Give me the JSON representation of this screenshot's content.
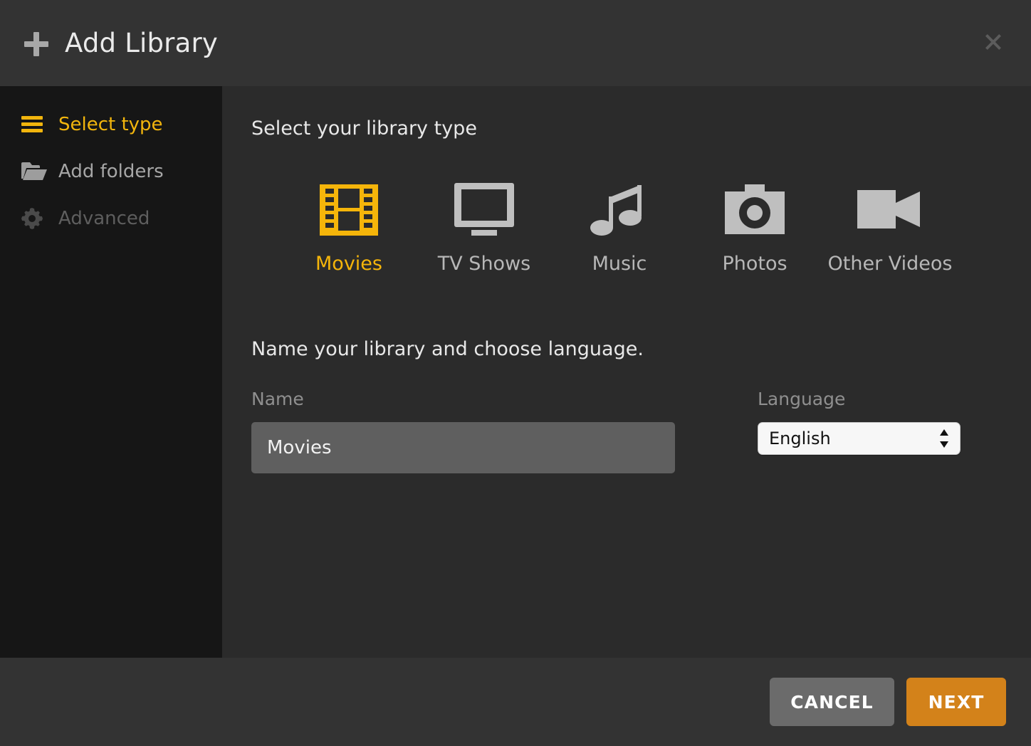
{
  "header": {
    "title": "Add Library",
    "plus_icon": "plus-icon",
    "close_icon": "close-icon"
  },
  "sidebar": {
    "items": [
      {
        "label": "Select type",
        "icon": "hamburger-icon",
        "state": "active"
      },
      {
        "label": "Add folders",
        "icon": "folder-open-icon",
        "state": "normal"
      },
      {
        "label": "Advanced",
        "icon": "gear-icon",
        "state": "disabled"
      }
    ]
  },
  "main": {
    "type_heading": "Select your library type",
    "library_types": [
      {
        "label": "Movies",
        "icon": "film-strip-icon",
        "selected": true
      },
      {
        "label": "TV Shows",
        "icon": "television-icon",
        "selected": false
      },
      {
        "label": "Music",
        "icon": "music-note-icon",
        "selected": false
      },
      {
        "label": "Photos",
        "icon": "camera-icon",
        "selected": false
      },
      {
        "label": "Other Videos",
        "icon": "video-camera-icon",
        "selected": false
      }
    ],
    "form_heading": "Name your library and choose language.",
    "name_field": {
      "label": "Name",
      "value": "Movies",
      "placeholder": "Name"
    },
    "language_field": {
      "label": "Language",
      "value": "English"
    }
  },
  "footer": {
    "cancel_label": "CANCEL",
    "next_label": "NEXT"
  },
  "colors": {
    "accent": "#f5b50a",
    "next_button": "#d3821a",
    "cancel_button": "#6b6b6b",
    "icon_gray": "#b7b7b7",
    "header_bg": "#333333",
    "sidebar_bg": "#161616",
    "content_bg": "#2b2b2b"
  }
}
